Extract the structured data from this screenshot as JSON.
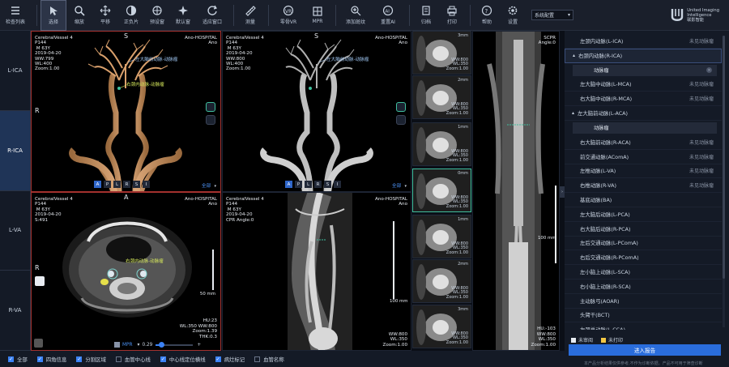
{
  "toolbar": {
    "buttons": [
      {
        "label": "检查列表",
        "icon": "list-icon"
      },
      {
        "label": "选择",
        "icon": "pointer-icon",
        "active": true
      },
      {
        "label": "缩放",
        "icon": "zoom-icon"
      },
      {
        "label": "平移",
        "icon": "pan-icon"
      },
      {
        "label": "正负片",
        "icon": "invert-icon"
      },
      {
        "label": "预设窗",
        "icon": "preset-window-icon"
      },
      {
        "label": "默认窗",
        "icon": "default-window-icon"
      },
      {
        "label": "适应窗口",
        "icon": "fit-window-icon"
      },
      {
        "label": "测量",
        "icon": "ruler-icon"
      },
      {
        "label": "零骨VR",
        "icon": "vr-icon"
      },
      {
        "label": "MPR",
        "icon": "mpr-icon"
      },
      {
        "label": "添加斑纹",
        "icon": "add-plaque-icon"
      },
      {
        "label": "重置AI",
        "icon": "reset-ai-icon"
      },
      {
        "label": "归档",
        "icon": "archive-icon"
      },
      {
        "label": "打印",
        "icon": "print-icon"
      },
      {
        "label": "帮助",
        "icon": "help-icon"
      },
      {
        "label": "设置",
        "icon": "settings-icon"
      }
    ],
    "preset_select": "系统配置",
    "logo_lines": [
      "United Imaging",
      "Intelligence",
      "联影智能"
    ]
  },
  "vessel_tabs": [
    {
      "label": "L-ICA",
      "active": false
    },
    {
      "label": "R-ICA",
      "active": true
    },
    {
      "label": "L-VA",
      "active": false
    },
    {
      "label": "R-VA",
      "active": false
    }
  ],
  "viewports": {
    "vr_color": {
      "info_tl": "CerebralVessel 4\nP144\n M 63Y\n2019-04-20\nWW:799\nWL:400\nZoom:1.00",
      "info_tr": "Ano-HOSPITAL\nAno",
      "orient_top": "S",
      "orient_left": "R",
      "annot_1": "左大脑前动脉-动脉瘤",
      "annot_2": "右颈内动脉-动脉瘤",
      "view_buttons": [
        "A",
        "P",
        "L",
        "R",
        "S",
        "I"
      ],
      "active_view": "A",
      "mode": "全部"
    },
    "vr_gray": {
      "info_tl": "CerebralVessel 4\nP144\n M 63Y\n2019-04-20\nWW:800\nWL:400\nZoom:1.00",
      "info_tr": "Ano-HOSPITAL\nAno",
      "orient_top": "S",
      "annot_1": "左大脑前动脉-动脉瘤",
      "view_buttons": [
        "A",
        "P",
        "L",
        "R",
        "S",
        "I"
      ],
      "active_view": "A",
      "mode": "全部"
    },
    "axial": {
      "info_tl": "CerebralVessel 4\nP144\n M 63Y\n2019-04-20\nS:491",
      "info_tr": "Ano-HOSPITAL\nAno",
      "info_br": "HU:23\nWL:350 WW:800\nZoom:1.39\nTHK:0.3",
      "orient_top": "A",
      "orient_left": "R",
      "annot": "右颈内动脉-动脉瘤",
      "scale": "50 mm",
      "mpr_label": "MPR",
      "thickness": "0.29"
    },
    "cpr": {
      "info_tl": "CerebralVessel 4\nP144\n M 63Y\n2019-04-20\nCPR Angle:0",
      "info_tr": "Ano-HOSPITAL\nAno",
      "info_br": "WW:800\nWL:350\nZoom:1.00",
      "scale": "100 mm"
    }
  },
  "thumbnails": [
    {
      "mm": "3mm",
      "info": "WW:800\nWL:350\nZoom:1.00"
    },
    {
      "mm": "2mm",
      "info": "WW:800\nWL:350\nZoom:1.00"
    },
    {
      "mm": "1mm",
      "info": "WW:800\nWL:350\nZoom:1.00"
    },
    {
      "mm": "0mm",
      "info": "WW:800\nWL:350\nZoom:1.00"
    },
    {
      "mm": "1mm",
      "info": "WW:800\nWL:350\nZoom:1.00"
    },
    {
      "mm": "2mm",
      "info": "WW:800\nWL:350\nZoom:1.00"
    },
    {
      "mm": "3mm",
      "info": "WW:800\nWL:350\nZoom:1.00"
    }
  ],
  "scpr": {
    "title": "SCPR",
    "angle": "Angle:0",
    "scale": "100 mm",
    "info_br": "HU:-103\nWW:800\nWL:350\nZoom:1.00"
  },
  "vessel_list": {
    "items": [
      {
        "name": "左颈内动脉(L-ICA)",
        "status": "未见动脉瘤"
      },
      {
        "name": "右颈内动脉(R-ICA)",
        "status": "",
        "expanded": true,
        "highlight": true,
        "children": [
          "动脉瘤"
        ]
      },
      {
        "name": "左大脑中动脉(L-MCA)",
        "status": "未见动脉瘤"
      },
      {
        "name": "右大脑中动脉(R-MCA)",
        "status": "未见动脉瘤"
      },
      {
        "name": "左大脑前动脉(L-ACA)",
        "status": "",
        "expanded": true,
        "children": [
          "动脉瘤"
        ]
      },
      {
        "name": "右大脑前动脉(R-ACA)",
        "status": "未见动脉瘤"
      },
      {
        "name": "前交通动脉(AComA)",
        "status": "未见动脉瘤"
      },
      {
        "name": "左椎动脉(L-VA)",
        "status": "未见动脉瘤"
      },
      {
        "name": "右椎动脉(R-VA)",
        "status": "未见动脉瘤"
      },
      {
        "name": "基底动脉(BA)",
        "status": ""
      },
      {
        "name": "左大脑后动脉(L-PCA)",
        "status": ""
      },
      {
        "name": "右大脑后动脉(R-PCA)",
        "status": ""
      },
      {
        "name": "左后交通动脉(L-PComA)",
        "status": ""
      },
      {
        "name": "右后交通动脉(R-PComA)",
        "status": ""
      },
      {
        "name": "左小脑上动脉(L-SCA)",
        "status": ""
      },
      {
        "name": "右小脑上动脉(R-SCA)",
        "status": ""
      },
      {
        "name": "主动脉弓(AOAR)",
        "status": ""
      },
      {
        "name": "头臂干(BCT)",
        "status": ""
      },
      {
        "name": "左颈总动脉(L-CCA)",
        "status": ""
      }
    ],
    "legend": [
      {
        "label": "未审阅",
        "color": "#e8ecf2"
      },
      {
        "label": "未打印",
        "color": "#f2c744"
      }
    ],
    "report_button": "进入报告",
    "disclaimer": "本产品分析结果仅供参考,不作为诊断依据。产品不可用于筛查诊断"
  },
  "bottom_bar": {
    "checkboxes": [
      {
        "label": "全部",
        "checked": true
      },
      {
        "label": "四角信息",
        "checked": true
      },
      {
        "label": "分割区域",
        "checked": true
      },
      {
        "label": "血管中心线",
        "checked": false
      },
      {
        "label": "中心线定位横线",
        "checked": true
      },
      {
        "label": "病灶标记",
        "checked": true
      },
      {
        "label": "血管名称",
        "checked": false
      }
    ]
  }
}
